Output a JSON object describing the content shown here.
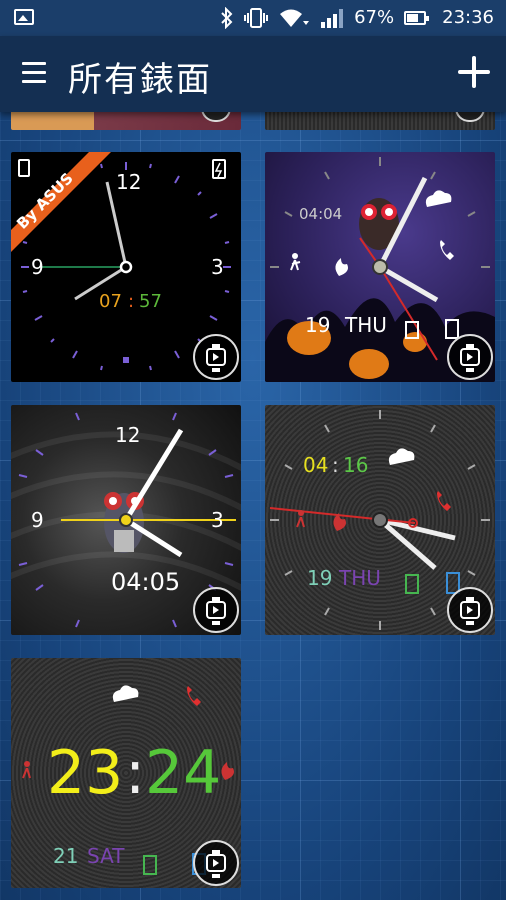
{
  "status_bar": {
    "battery": "67%",
    "time": "23:36",
    "icons": [
      "image-icon",
      "bluetooth-icon",
      "vibrate-icon",
      "wifi-icon",
      "signal-icon",
      "battery-icon"
    ]
  },
  "app_bar": {
    "title": "所有錶面",
    "menu_icon": "hamburger-menu-icon",
    "add_icon": "plus-icon"
  },
  "watch_faces": [
    {
      "id_label": "asus-analog",
      "badge": "By ASUS",
      "numerals": [
        "12",
        "3",
        "9"
      ],
      "time_hours": "07",
      "time_sep": ":",
      "time_minutes": "57",
      "colors": {
        "hours": "#e8a21e",
        "minutes": "#5cb83a",
        "badge": "#e8601c"
      }
    },
    {
      "id_label": "halloween",
      "digital_time": "04:04",
      "date_day": "19",
      "date_weekday": "THU"
    },
    {
      "id_label": "robot-vinyl",
      "numerals": [
        "12",
        "3",
        "9"
      ],
      "digital_time": "04:05"
    },
    {
      "id_label": "metal-analog",
      "time_hours": "04",
      "time_sep": ":",
      "time_minutes": "16",
      "date_day": "19",
      "date_weekday": "THU",
      "colors": {
        "hours": "#e6e020",
        "minutes": "#5cc848",
        "day": "#7fd0b8",
        "weekday": "#7a44b0"
      }
    },
    {
      "id_label": "metal-digital",
      "time_hours": "23",
      "time_sep": ":",
      "time_minutes": "24",
      "date_day": "21",
      "date_weekday": "SAT",
      "colors": {
        "hours": "#f2ee1a",
        "minutes": "#56c83a",
        "day": "#7fd0b8",
        "weekday": "#7a44b0"
      }
    }
  ]
}
